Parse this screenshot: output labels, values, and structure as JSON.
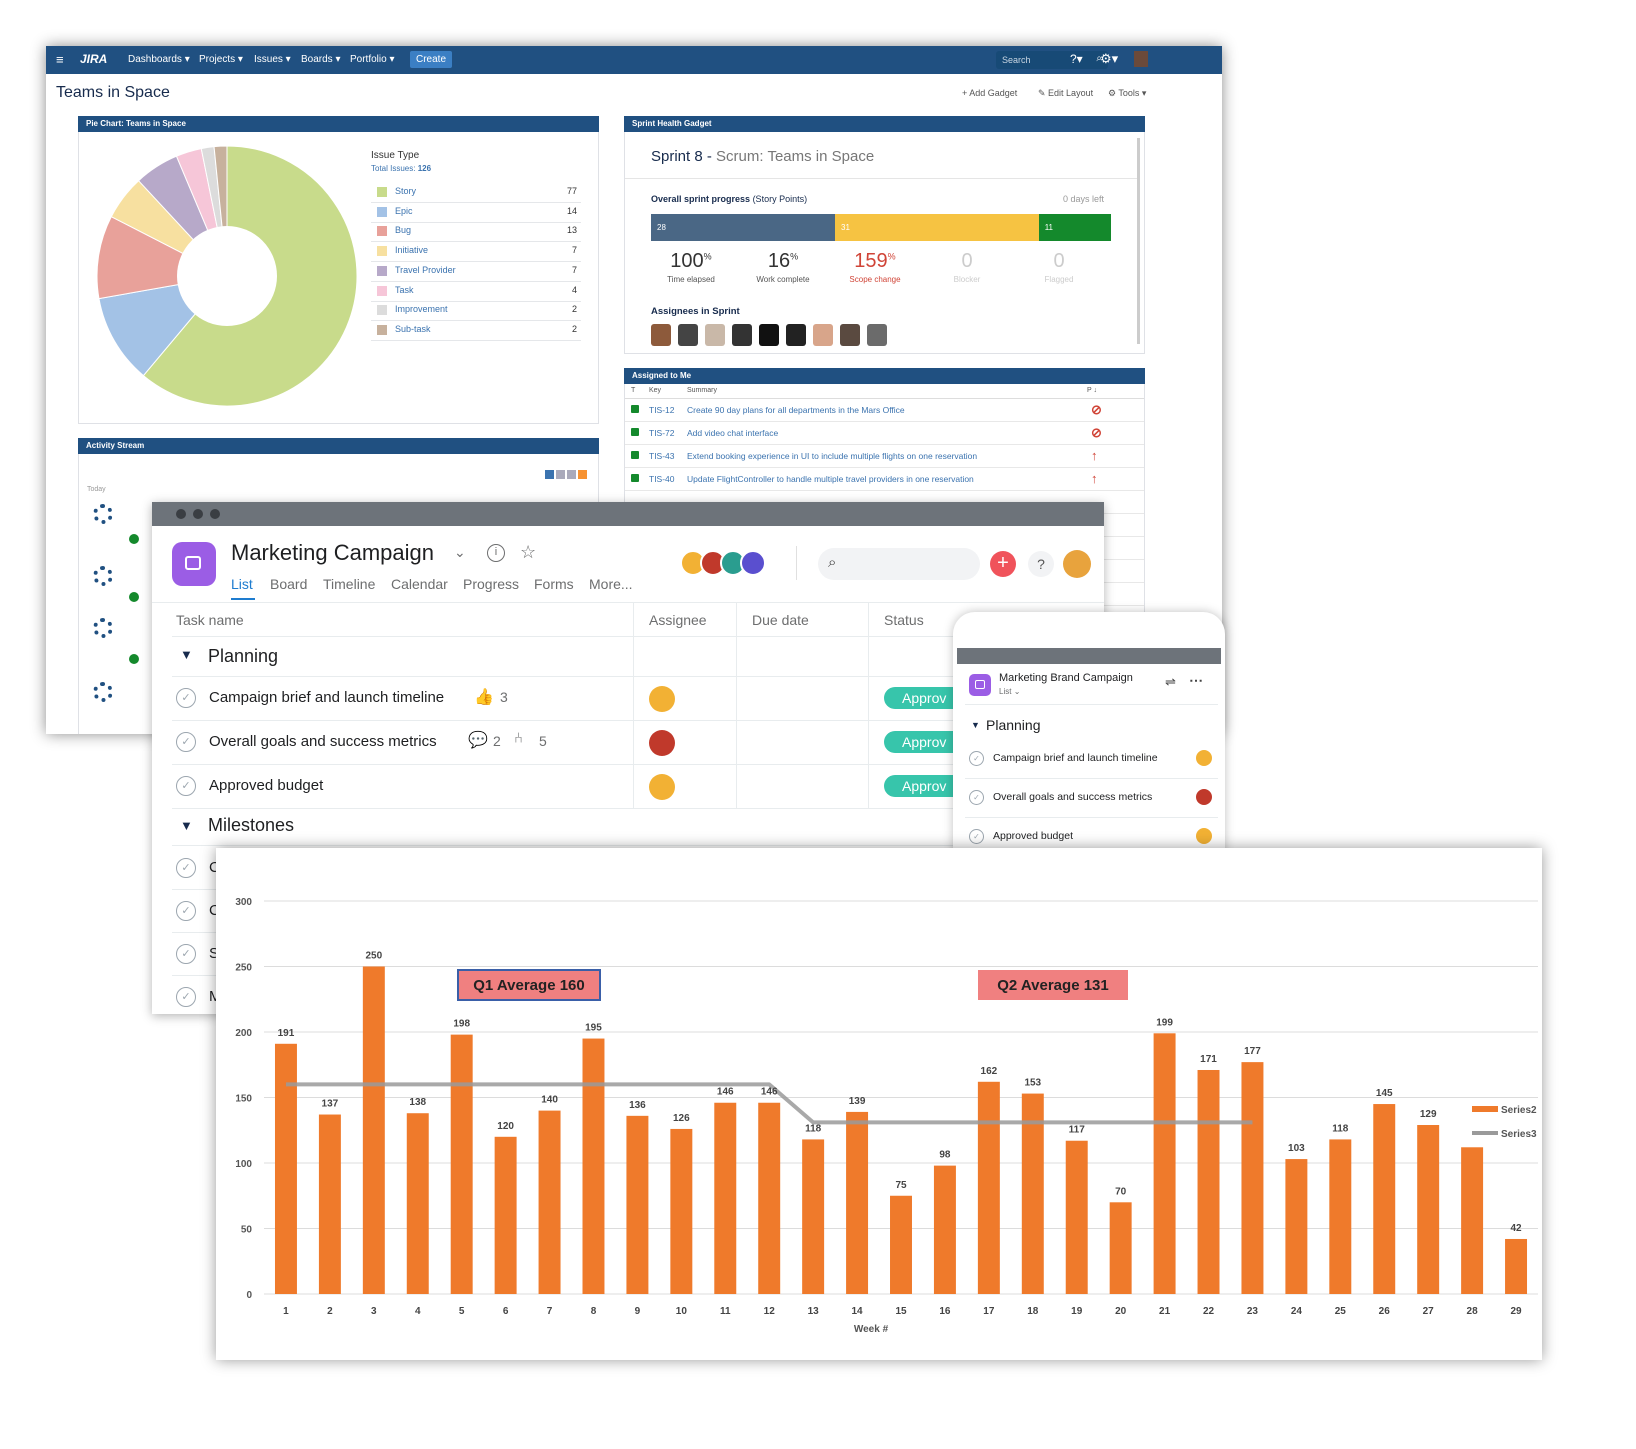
{
  "jira": {
    "logo": "JIRA",
    "nav": [
      "Dashboards ▾",
      "Projects ▾",
      "Issues ▾",
      "Boards ▾",
      "Portfolio ▾"
    ],
    "create": "Create",
    "search_placeholder": "Search",
    "page_title": "Teams in Space",
    "actions": {
      "add_gadget": "Add Gadget",
      "edit_layout": "Edit Layout",
      "tools": "Tools ▾"
    },
    "pie": {
      "header": "Pie Chart: Teams in Space",
      "title": "Issue Type",
      "total_label": "Total Issues:",
      "total": "126",
      "legend": [
        {
          "name": "Story",
          "count": "77",
          "color": "#c8db8b"
        },
        {
          "name": "Epic",
          "count": "14",
          "color": "#a3c2e6"
        },
        {
          "name": "Bug",
          "count": "13",
          "color": "#e8a19a"
        },
        {
          "name": "Initiative",
          "count": "7",
          "color": "#f7e0a0"
        },
        {
          "name": "Travel Provider",
          "count": "7",
          "color": "#b7a9c9"
        },
        {
          "name": "Task",
          "count": "4",
          "color": "#f6c6d8"
        },
        {
          "name": "Improvement",
          "count": "2",
          "color": "#dcdcdc"
        },
        {
          "name": "Sub-task",
          "count": "2",
          "color": "#c7b19d"
        }
      ]
    },
    "sprint": {
      "header": "Sprint Health Gadget",
      "title": "Sprint 8",
      "subtitle": "Scrum: Teams in Space",
      "progress_label": "Overall sprint progress",
      "progress_unit": "(Story Points)",
      "days_left": "0 days left",
      "segments": [
        {
          "value": "28",
          "color": "#4a6785"
        },
        {
          "value": "31",
          "color": "#f6c342"
        },
        {
          "value": "11",
          "color": "#14892c"
        }
      ],
      "stats": [
        {
          "value": "100",
          "unit": "%",
          "label": "Time elapsed"
        },
        {
          "value": "16",
          "unit": "%",
          "label": "Work complete"
        },
        {
          "value": "159",
          "unit": "%",
          "label": "Scope change"
        },
        {
          "value": "0",
          "unit": "",
          "label": "Blocker"
        },
        {
          "value": "0",
          "unit": "",
          "label": "Flagged"
        }
      ],
      "assignees_label": "Assignees in Sprint"
    },
    "assigned": {
      "header": "Assigned to Me",
      "cols": {
        "t": "T",
        "key": "Key",
        "summary": "Summary",
        "p": "P ↓"
      },
      "rows": [
        {
          "key": "TIS-12",
          "summary": "Create 90 day plans for all departments in the Mars Office",
          "p": "⊘"
        },
        {
          "key": "TIS-72",
          "summary": "Add video chat interface",
          "p": "⊘"
        },
        {
          "key": "TIS-43",
          "summary": "Extend booking experience in UI to include multiple flights on one reservation",
          "p": "↑"
        },
        {
          "key": "TIS-40",
          "summary": "Update FlightController to handle multiple travel providers in one reservation",
          "p": "↑"
        }
      ]
    },
    "activity": {
      "header": "Activity Stream",
      "today": "Today"
    }
  },
  "asana": {
    "project_title": "Marketing Campaign",
    "tabs": [
      "List",
      "Board",
      "Timeline",
      "Calendar",
      "Progress",
      "Forms",
      "More..."
    ],
    "columns": [
      "Task name",
      "Assignee",
      "Due date",
      "Status"
    ],
    "sections": [
      {
        "name": "Planning",
        "tasks": [
          {
            "name": "Campaign brief and launch timeline",
            "likes": "3",
            "status": "Approv"
          },
          {
            "name": "Overall goals and success metrics",
            "comments": "2",
            "subtasks": "5",
            "status": "Approv"
          },
          {
            "name": "Approved budget",
            "status": "Approv"
          }
        ]
      },
      {
        "name": "Milestones",
        "tasks": [
          {
            "name": "C"
          },
          {
            "name": "C"
          },
          {
            "name": "S"
          },
          {
            "name": "M"
          }
        ]
      }
    ],
    "mobile": {
      "title": "Marketing Brand Campaign",
      "view": "List",
      "section": "Planning",
      "tasks": [
        "Campaign brief and launch timeline",
        "Overall goals and success metrics",
        "Approved budget"
      ]
    }
  },
  "chart_data": {
    "type": "bar",
    "xlabel": "Week #",
    "ylabel": "",
    "ylim": [
      0,
      300
    ],
    "yticks": [
      0,
      50,
      100,
      150,
      200,
      250,
      300
    ],
    "categories": [
      "1",
      "2",
      "3",
      "4",
      "5",
      "6",
      "7",
      "8",
      "9",
      "10",
      "11",
      "12",
      "13",
      "14",
      "15",
      "16",
      "17",
      "18",
      "19",
      "20",
      "21",
      "22",
      "23",
      "24",
      "25",
      "26",
      "27",
      "28",
      "29"
    ],
    "series": [
      {
        "name": "Series2",
        "type": "bar",
        "color": "#ef7a2b",
        "values": [
          191,
          137,
          250,
          138,
          198,
          120,
          140,
          195,
          136,
          126,
          146,
          146,
          118,
          139,
          75,
          98,
          162,
          153,
          117,
          70,
          199,
          171,
          177,
          103,
          118,
          145,
          129,
          112,
          42
        ]
      },
      {
        "name": "Series3",
        "type": "line",
        "color": "#9a9a9a",
        "values": [
          160,
          160,
          160,
          160,
          160,
          160,
          160,
          160,
          160,
          160,
          160,
          160,
          131,
          131,
          131,
          131,
          131,
          131,
          131,
          131,
          131,
          131,
          131,
          null,
          null,
          null,
          null,
          null,
          null
        ]
      }
    ],
    "data_labels": [
      "191",
      "137",
      "250",
      "138",
      "198",
      "120",
      "140",
      "195",
      "136",
      "126",
      "146",
      "146",
      "118",
      "139",
      "75",
      "98",
      "162",
      "153",
      "117",
      "70",
      "199",
      "171",
      "177",
      "103",
      "118",
      "145",
      "129",
      "",
      "42"
    ],
    "annotations": [
      {
        "text": "Q1 Average 160",
        "color": "#f08080"
      },
      {
        "text": "Q2 Average 131",
        "color": "#f08080"
      }
    ],
    "legend_position": "right",
    "grid": true
  }
}
